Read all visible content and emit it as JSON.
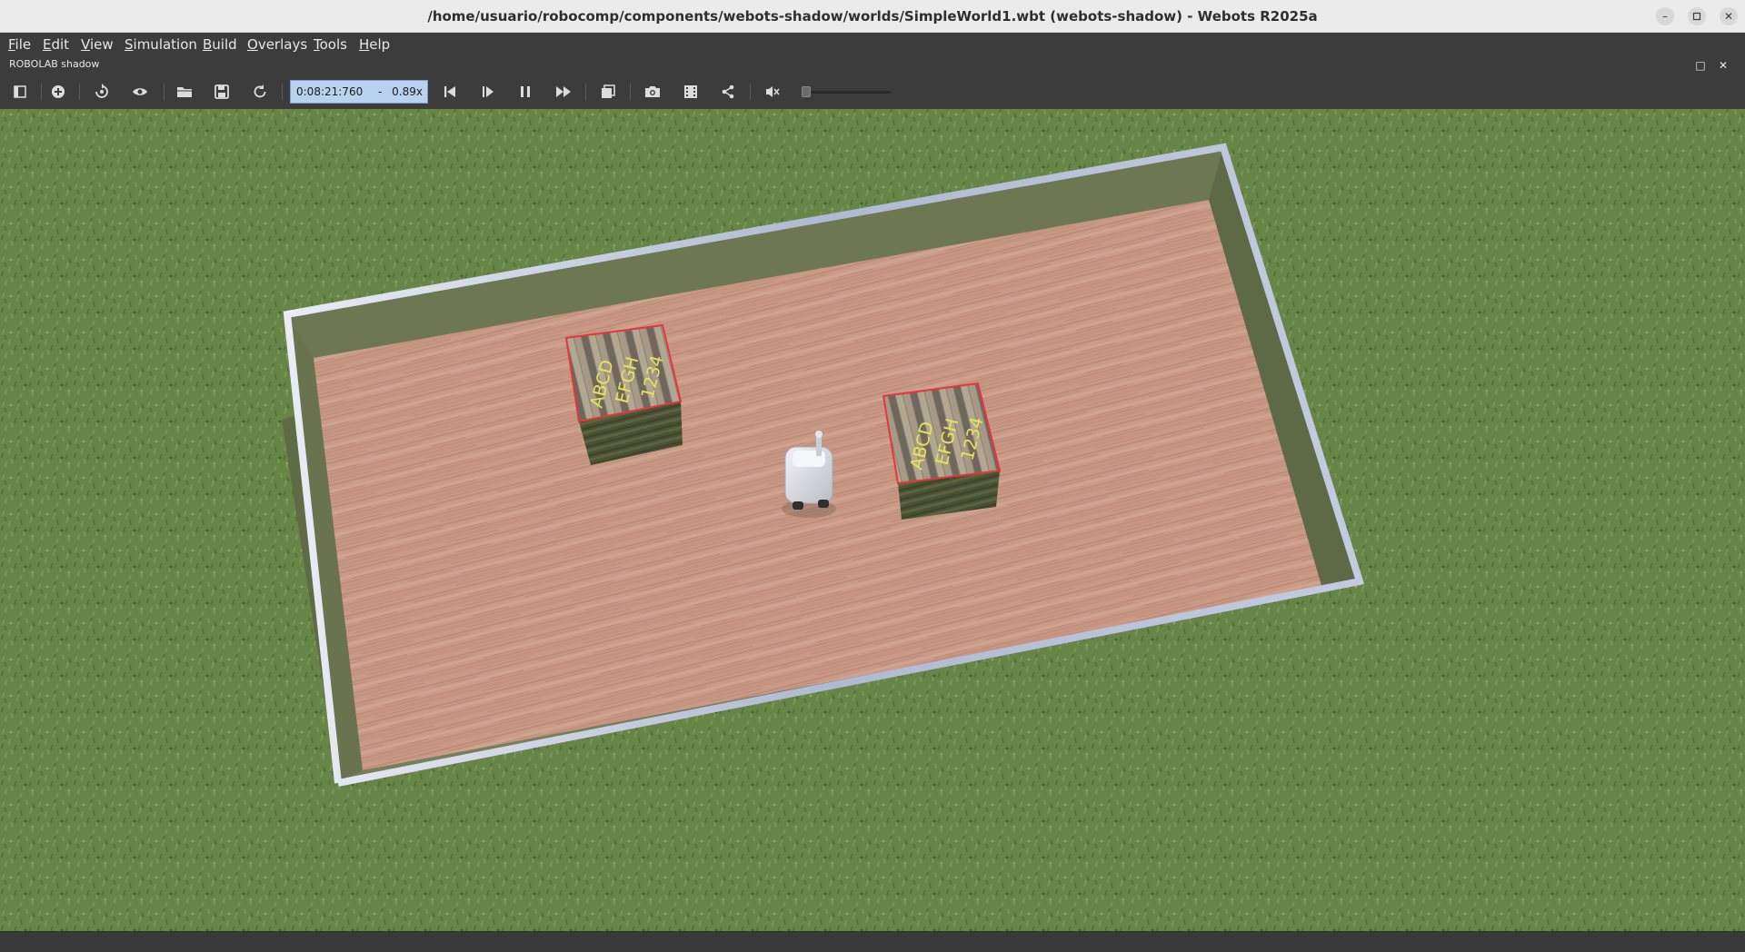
{
  "window": {
    "title": "/home/usuario/robocomp/components/webots-shadow/worlds/SimpleWorld1.wbt (webots-shadow) - Webots R2025a",
    "controls": {
      "minimize": "–",
      "maximize": "▫",
      "close": "✕"
    }
  },
  "menu": {
    "items": [
      {
        "label": "File",
        "mnemonic": "F"
      },
      {
        "label": "Edit",
        "mnemonic": "E"
      },
      {
        "label": "View",
        "mnemonic": "V"
      },
      {
        "label": "Simulation",
        "mnemonic": "S"
      },
      {
        "label": "Build",
        "mnemonic": "B"
      },
      {
        "label": "Overlays",
        "mnemonic": "O"
      },
      {
        "label": "Tools",
        "mnemonic": "T"
      },
      {
        "label": "Help",
        "mnemonic": "H"
      }
    ]
  },
  "view_panel": {
    "title": "ROBOLAB shadow",
    "float_icon": "□",
    "close_icon": "✕"
  },
  "toolbar": {
    "simulation_time": "0:08:21:760",
    "separator": "-",
    "speed": "0.89x",
    "volume_level": 0,
    "icons": [
      "hide-scene-tree-icon",
      "add-node-icon",
      "reset-view-icon",
      "view-options-icon",
      "open-world-icon",
      "save-world-icon",
      "reload-world-icon",
      "reset-simulation-icon",
      "step-icon",
      "pause-icon",
      "fast-forward-icon",
      "rendering-icon",
      "screenshot-icon",
      "record-movie-icon",
      "share-icon",
      "mute-icon"
    ]
  },
  "scene": {
    "box_labels": {
      "line1": "ABCD",
      "line2": "EFGH",
      "line3": "1234"
    },
    "colors": {
      "grass": "#6f8f4e",
      "floor": "#c99a86",
      "wall_inner": "#6b7552",
      "wall_top": "#b9c3d9",
      "box_outline": "#e8353a",
      "box_text": "#e7e45a",
      "robot": "#dde0e6"
    }
  }
}
